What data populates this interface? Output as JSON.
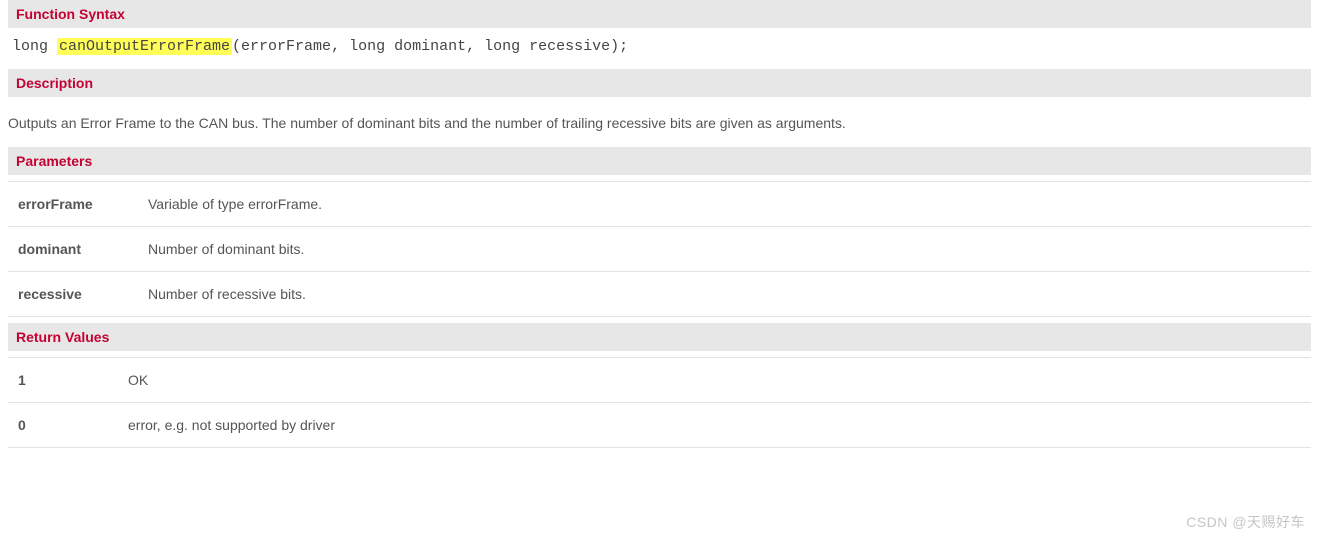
{
  "sections": {
    "function_syntax": {
      "title": "Function Syntax",
      "code_prefix": "long ",
      "code_name": "canOutputErrorFrame",
      "code_suffix": "(errorFrame, long dominant, long recessive);"
    },
    "description": {
      "title": "Description",
      "text": "Outputs an Error Frame to the CAN bus. The number of dominant bits and the number of trailing recessive bits are given as arguments."
    },
    "parameters": {
      "title": "Parameters",
      "rows": [
        {
          "name": "errorFrame",
          "desc": "Variable of type errorFrame."
        },
        {
          "name": "dominant",
          "desc": "Number of dominant bits."
        },
        {
          "name": "recessive",
          "desc": "Number of recessive bits."
        }
      ]
    },
    "return_values": {
      "title": "Return Values",
      "rows": [
        {
          "val": "1",
          "desc": "OK"
        },
        {
          "val": "0",
          "desc": "error, e.g. not supported by driver"
        }
      ]
    }
  },
  "watermark": "CSDN @天赐好车"
}
